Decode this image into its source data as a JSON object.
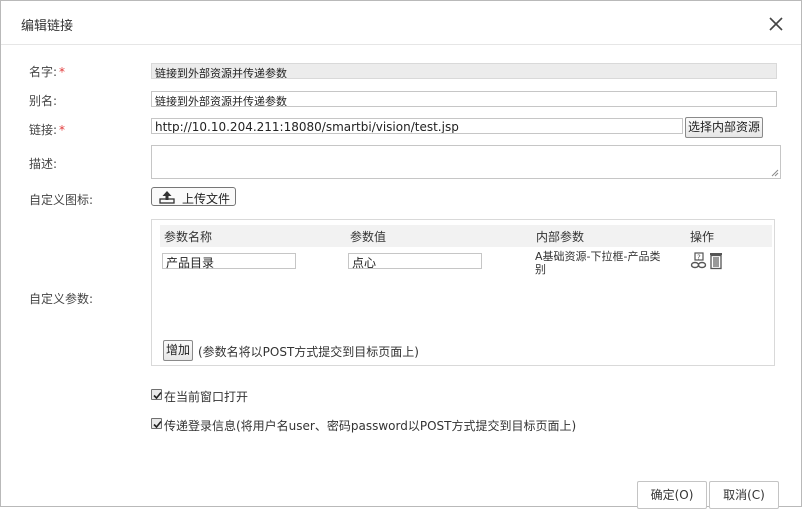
{
  "dialog": {
    "title": "编辑链接",
    "close_icon": "close-icon"
  },
  "form": {
    "name": {
      "label": "名字:",
      "required_mark": "*",
      "value": "链接到外部资源并传递参数"
    },
    "alias": {
      "label": "别名:",
      "value": "链接到外部资源并传递参数"
    },
    "link": {
      "label": "链接:",
      "required_mark": "*",
      "value": "http://10.10.204.211:18080/smartbi/vision/test.jsp",
      "choose_button": "选择内部资源"
    },
    "description": {
      "label": "描述:",
      "value": ""
    },
    "custom_icon": {
      "label": "自定义图标:",
      "upload_button": "上传文件",
      "icon": "upload-icon"
    },
    "custom_params": {
      "label": "自定义参数:",
      "columns": [
        "参数名称",
        "参数值",
        "内部参数",
        "操作"
      ],
      "rows": [
        {
          "name": "产品目录",
          "value": "点心",
          "internal": "A基础资源-下拉框-产品类别",
          "ops": [
            "link-params-icon",
            "delete-icon"
          ]
        }
      ],
      "add_button": "增加",
      "add_note": "(参数名将以POST方式提交到目标页面上)"
    },
    "open_current_window": {
      "label": "在当前窗口打开",
      "checked": true
    },
    "pass_login_info": {
      "label": "传递登录信息(将用户名user、密码password以POST方式提交到目标页面上)",
      "checked": true
    }
  },
  "footer": {
    "ok": "确定(O)",
    "cancel": "取消(C)"
  }
}
